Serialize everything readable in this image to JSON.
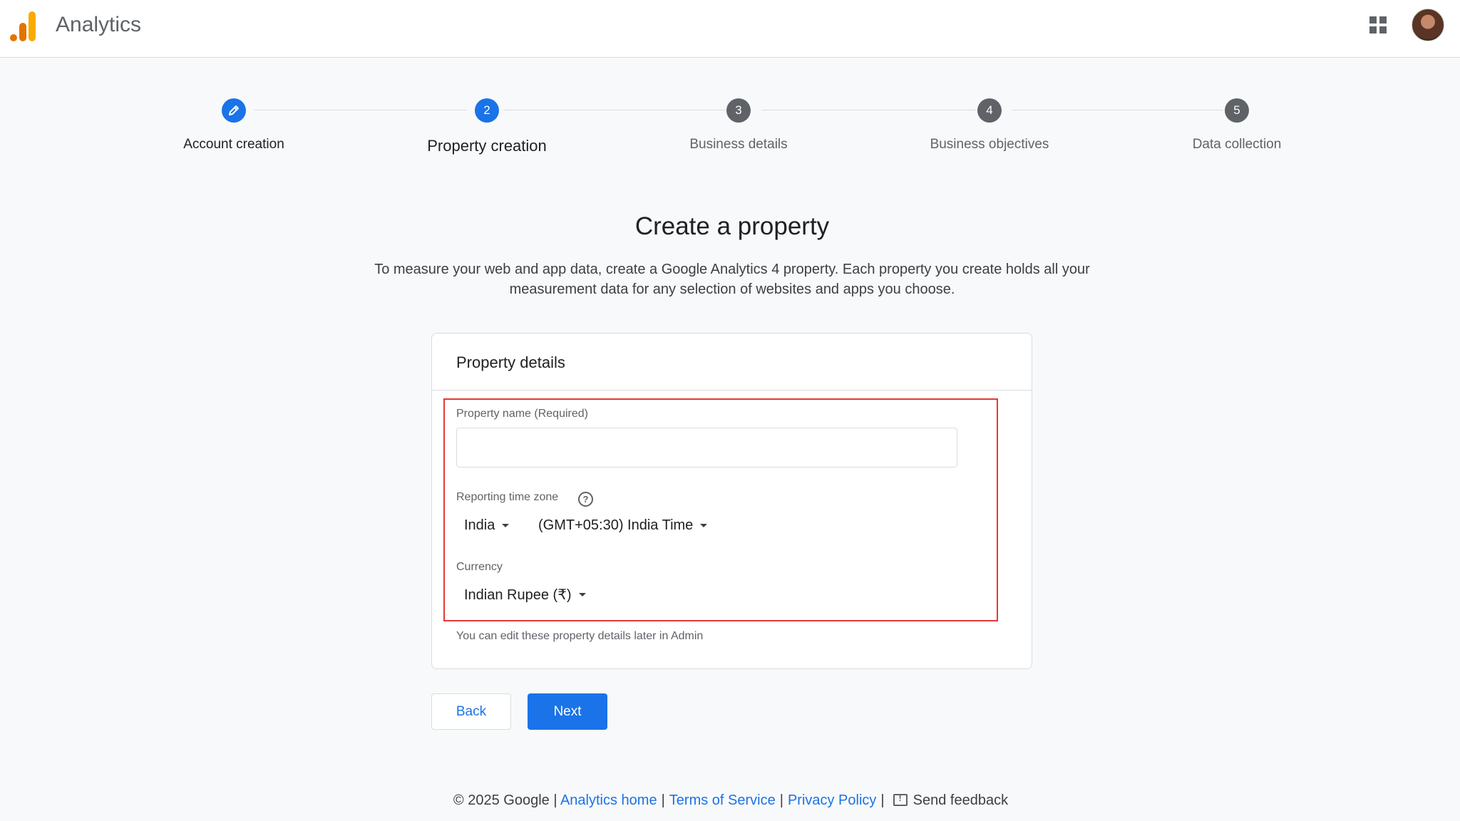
{
  "header": {
    "app_title": "Analytics"
  },
  "stepper": {
    "steps": [
      {
        "number": "",
        "label": "Account creation",
        "state": "done"
      },
      {
        "number": "2",
        "label": "Property creation",
        "state": "active"
      },
      {
        "number": "3",
        "label": "Business details",
        "state": "todo"
      },
      {
        "number": "4",
        "label": "Business objectives",
        "state": "todo"
      },
      {
        "number": "5",
        "label": "Data collection",
        "state": "todo"
      }
    ]
  },
  "main": {
    "title": "Create a property",
    "description": "To measure your web and app data, create a Google Analytics 4 property. Each property you create holds all your measurement data for any selection of websites and apps you choose."
  },
  "card": {
    "title": "Property details",
    "property_name": {
      "label": "Property name (Required)",
      "value": "",
      "placeholder": ""
    },
    "time_zone": {
      "label": "Reporting time zone",
      "country": "India",
      "zone": "(GMT+05:30) India Time"
    },
    "currency": {
      "label": "Currency",
      "value": "Indian Rupee (₹)"
    },
    "hint": "You can edit these property details later in Admin"
  },
  "actions": {
    "back_label": "Back",
    "next_label": "Next"
  },
  "footer": {
    "copyright": "© 2025 Google |",
    "analytics_home": "Analytics home",
    "terms": "Terms of Service",
    "privacy": "Privacy Policy",
    "feedback": "Send feedback"
  },
  "colors": {
    "accent": "#1a73e8",
    "highlight_border": "#e53935",
    "logo_orange": "#e37400",
    "logo_yellow": "#f9ab00"
  },
  "icons": [
    "analytics-logo",
    "apps-grid-icon",
    "avatar",
    "edit-pencil-icon",
    "help-icon",
    "caret-down-icon",
    "feedback-icon"
  ]
}
